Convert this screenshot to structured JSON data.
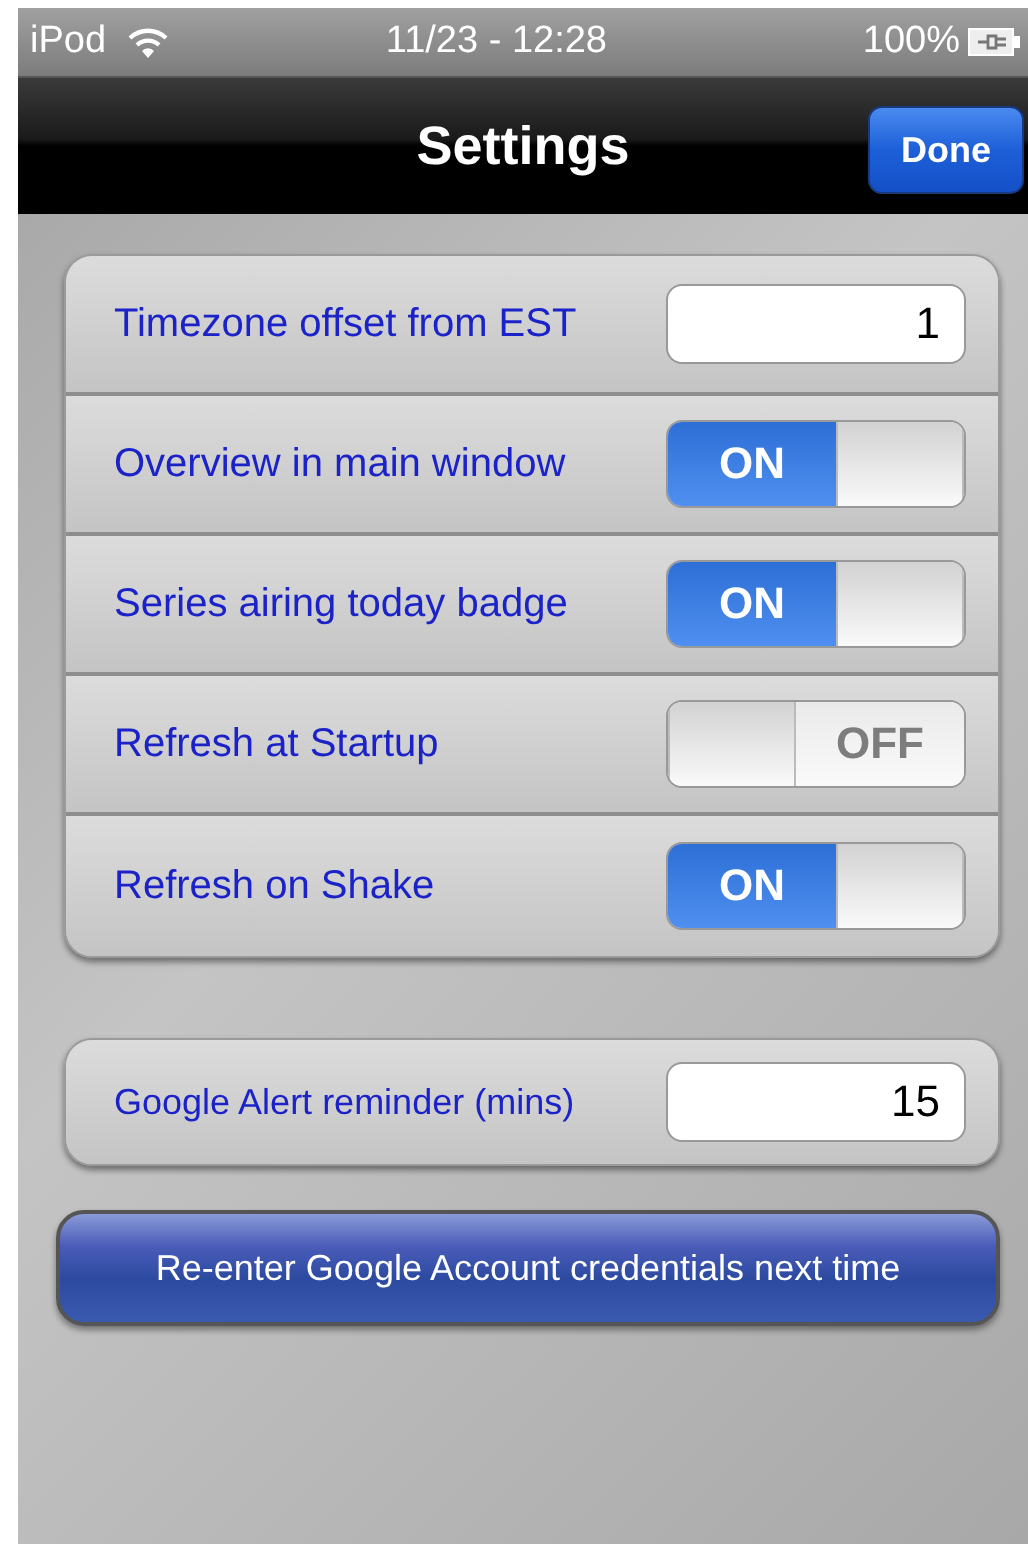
{
  "status_bar": {
    "device": "iPod",
    "time": "11/23 - 12:28",
    "battery": "100%"
  },
  "nav_bar": {
    "title": "Settings",
    "done_button": "Done"
  },
  "settings": [
    {
      "kind": "field",
      "label": "Timezone offset from EST",
      "value": "1"
    },
    {
      "kind": "switch",
      "label": "Overview in main window",
      "on": true,
      "state_label": "ON"
    },
    {
      "kind": "switch",
      "label": "Series airing today badge",
      "on": true,
      "state_label": "ON"
    },
    {
      "kind": "switch",
      "label": "Refresh at Startup",
      "on": false,
      "state_label": "OFF"
    },
    {
      "kind": "switch",
      "label": "Refresh on Shake",
      "on": true,
      "state_label": "ON"
    }
  ],
  "reminder": {
    "kind": "field",
    "label": "Google Alert reminder (mins)",
    "value": "15"
  },
  "reset_button": "Re-enter Google Account credentials next time"
}
